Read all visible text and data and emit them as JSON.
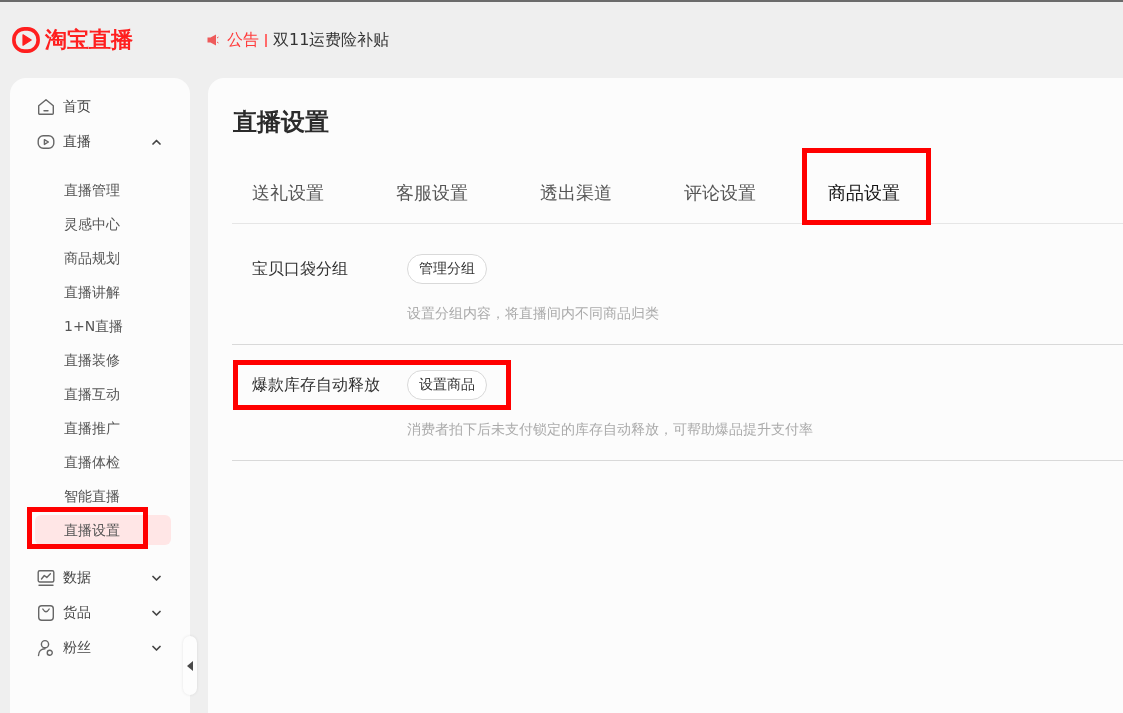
{
  "header": {
    "logo": "淘宝直播",
    "announcement": {
      "label": "公告",
      "text": "双11运费险补贴"
    }
  },
  "sidebar": {
    "items": [
      {
        "kind": "link",
        "label": "首页",
        "selected": false
      },
      {
        "kind": "group",
        "label": "直播",
        "selected": false,
        "expanded": true,
        "children": [
          {
            "label": "直播管理",
            "selected": false,
            "annotated": false
          },
          {
            "label": "灵感中心",
            "selected": false,
            "annotated": false
          },
          {
            "label": "商品规划",
            "selected": false,
            "annotated": false
          },
          {
            "label": "直播讲解",
            "selected": false,
            "annotated": false
          },
          {
            "label": "1+N直播",
            "selected": false,
            "annotated": false
          },
          {
            "label": "直播装修",
            "selected": false,
            "annotated": false
          },
          {
            "label": "直播互动",
            "selected": false,
            "annotated": false
          },
          {
            "label": "直播推广",
            "selected": false,
            "annotated": false
          },
          {
            "label": "直播体检",
            "selected": false,
            "annotated": false
          },
          {
            "label": "智能直播",
            "selected": false,
            "annotated": false
          },
          {
            "label": "直播设置",
            "selected": true,
            "annotated": true
          }
        ]
      },
      {
        "kind": "group",
        "label": "数据",
        "selected": false,
        "expanded": false
      },
      {
        "kind": "group",
        "label": "货品",
        "selected": false,
        "expanded": false
      },
      {
        "kind": "group",
        "label": "粉丝",
        "selected": false,
        "expanded": false
      }
    ]
  },
  "page": {
    "title": "直播设置",
    "tabs": [
      {
        "label": "送礼设置",
        "selected": false,
        "annotated": false
      },
      {
        "label": "客服设置",
        "selected": false,
        "annotated": false
      },
      {
        "label": "透出渠道",
        "selected": false,
        "annotated": false
      },
      {
        "label": "评论设置",
        "selected": false,
        "annotated": false
      },
      {
        "label": "商品设置",
        "selected": true,
        "annotated": true
      }
    ],
    "settings": [
      {
        "label": "宝贝口袋分组",
        "button": "管理分组",
        "description": "设置分组内容，将直播间内不同商品归类",
        "annotated": false
      },
      {
        "label": "爆款库存自动释放",
        "button": "设置商品",
        "description": "消费者拍下后未支付锁定的库存自动释放，可帮助爆品提升支付率",
        "annotated": true
      }
    ]
  }
}
